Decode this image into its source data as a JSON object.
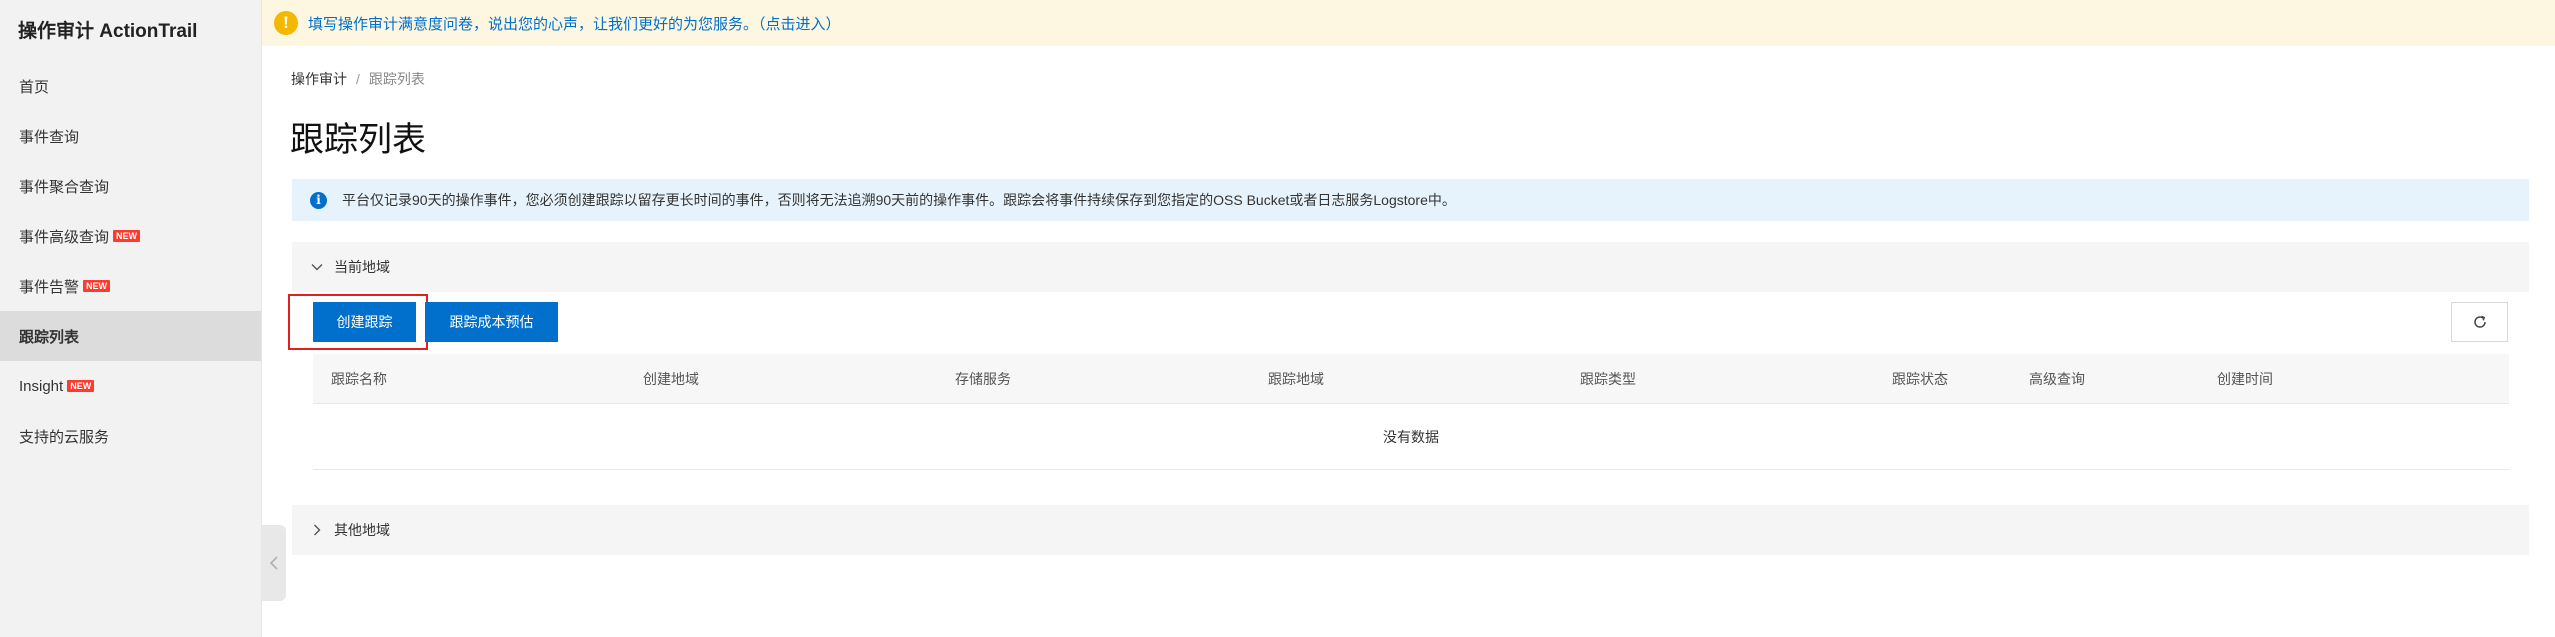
{
  "sidebar": {
    "brand": "操作审计 ActionTrail",
    "new_badge": "NEW",
    "items": [
      {
        "label": "首页"
      },
      {
        "label": "事件查询"
      },
      {
        "label": "事件聚合查询"
      },
      {
        "label": "事件高级查询"
      },
      {
        "label": "事件告警"
      },
      {
        "label": "跟踪列表"
      },
      {
        "label": "Insight"
      },
      {
        "label": "支持的云服务"
      }
    ]
  },
  "survey": {
    "icon": "warning-icon",
    "text": "填写操作审计满意度问卷，说出您的心声，让我们更好的为您服务。（点击进入）"
  },
  "breadcrumb": {
    "root": "操作审计",
    "separator": "/",
    "current": "跟踪列表"
  },
  "page_title": "跟踪列表",
  "info": {
    "icon": "info-icon",
    "text": "平台仅记录90天的操作事件，您必须创建跟踪以留存更长时间的事件，否则将无法追溯90天前的操作事件。跟踪会将事件持续保存到您指定的OSS Bucket或者日志服务Logstore中。"
  },
  "current_region": {
    "label": "当前地域"
  },
  "other_region": {
    "label": "其他地域"
  },
  "toolbar": {
    "create_label": "创建跟踪",
    "estimate_label": "跟踪成本预估"
  },
  "table": {
    "columns": [
      "跟踪名称",
      "创建地域",
      "存储服务",
      "跟踪地域",
      "跟踪类型",
      "跟踪状态",
      "高级查询",
      "创建时间"
    ],
    "empty_text": "没有数据"
  },
  "colors": {
    "primary": "#0070cc",
    "highlight": "#e02020",
    "warning": "#f5b800",
    "badge": "#ff3b30"
  }
}
